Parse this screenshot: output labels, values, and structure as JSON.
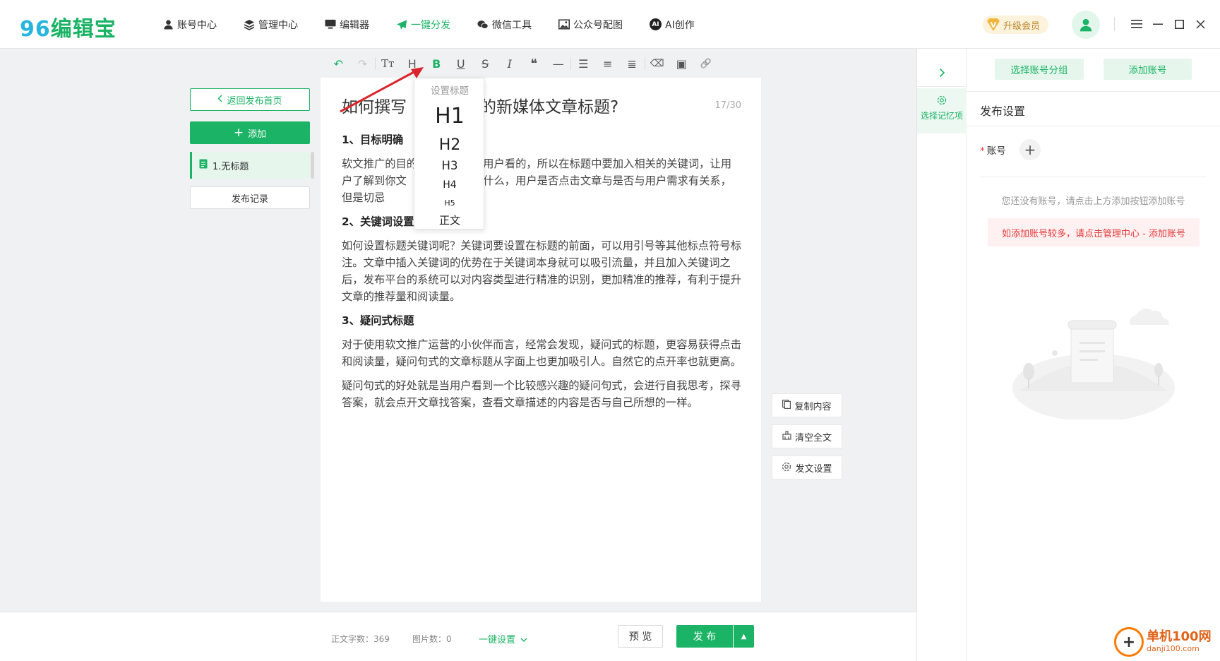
{
  "app": {
    "logo_num": "96",
    "logo_text": "编辑宝",
    "brand_color": "#1bb365"
  },
  "nav": [
    {
      "label": "账号中心",
      "icon": "user-icon"
    },
    {
      "label": "管理中心",
      "icon": "layers-icon"
    },
    {
      "label": "编辑器",
      "icon": "monitor-icon"
    },
    {
      "label": "一键分发",
      "icon": "send-icon",
      "active": true
    },
    {
      "label": "微信工具",
      "icon": "wechat-icon"
    },
    {
      "label": "公众号配图",
      "icon": "image-icon"
    },
    {
      "label": "AI创作",
      "icon": "ai-icon",
      "badge": "AI"
    }
  ],
  "header": {
    "upgrade_label": "升级会员",
    "upgrade_badge": "V"
  },
  "left": {
    "back_label": "返回发布首页",
    "add_label": "添加",
    "doc_label": "1.无标题",
    "record_label": "发布记录"
  },
  "toolbar": [
    {
      "name": "undo-button",
      "glyph": "↶"
    },
    {
      "name": "redo-button",
      "glyph": "↷"
    },
    {
      "name": "font-size-button",
      "glyph": "Tт"
    },
    {
      "name": "heading-button",
      "glyph": "H"
    },
    {
      "name": "bold-button",
      "glyph": "B"
    },
    {
      "name": "underline-button",
      "glyph": "U"
    },
    {
      "name": "strikethrough-button",
      "glyph": "S"
    },
    {
      "name": "italic-button",
      "glyph": "I"
    },
    {
      "name": "quote-button",
      "glyph": "❝"
    },
    {
      "name": "horizontal-rule-button",
      "glyph": "—"
    },
    {
      "name": "bullet-list-button",
      "glyph": "☰"
    },
    {
      "name": "align-left-button",
      "glyph": "≡"
    },
    {
      "name": "indent-button",
      "glyph": "≣"
    },
    {
      "name": "clear-format-button",
      "glyph": "⌫"
    },
    {
      "name": "insert-image-button",
      "glyph": "▣"
    },
    {
      "name": "insert-link-button",
      "glyph": "🔗"
    }
  ],
  "editor": {
    "title_part1": "如何撰写",
    "title_part2": "的新媒体文章标题?",
    "title_count": "17/30",
    "sections": [
      {
        "heading": "1、目标明确",
        "paragraphs": [
          "软文推广的目的                给用户看的，所以在标题中要加入相关的关键词，让用户了解到你文                容是什么，用户是否点击文章与是否与用户需求有关系，但是切忌"
        ]
      },
      {
        "heading": "2、关键词设置",
        "paragraphs": [
          "如何设置标题关键词呢？关键词要设置在标题的前面，可以用引号等其他标点符号标注。文章中插入关键词的优势在于关键词本身就可以吸引流量，并且加入关键词之后，发布平台的系统可以对内容类型进行精准的识别，更加精准的推荐，有利于提升文章的推荐量和阅读量。"
        ]
      },
      {
        "heading": "3、疑问式标题",
        "paragraphs": [
          "对于使用软文推广运营的小伙伴而言，经常会发现，疑问式的标题，更容易获得点击和阅读量，疑问句式的文章标题从字面上也更加吸引人。自然它的点开率也就更高。",
          "疑问句式的好处就是当用户看到一个比较感兴趣的疑问句式，会进行自我思考，探寻答案，就会点开文章找答案，查看文章描述的内容是否与自己所想的一样。"
        ]
      }
    ]
  },
  "heading_dropdown": {
    "title": "设置标题",
    "options": [
      "H1",
      "H2",
      "H3",
      "H4",
      "H5",
      "正文"
    ]
  },
  "side_actions": [
    {
      "label": "复制内容",
      "icon": "copy-icon"
    },
    {
      "label": "清空全文",
      "icon": "clear-icon"
    },
    {
      "label": "发文设置",
      "icon": "settings-icon"
    }
  ],
  "bottom": {
    "word_count": "正文字数：369",
    "image_count": "图片数：0",
    "one_click": "一键设置",
    "preview": "预 览",
    "publish": "发 布"
  },
  "right_panel": {
    "memory_label": "选择记忆项",
    "select_group": "选择账号分组",
    "add_account": "添加账号",
    "header": "发布设置",
    "account_label": "账号",
    "empty_text": "您还没有账号，请点击上方添加按钮添加账号",
    "warning": "如添加账号较多，请点击管理中心 - 添加账号"
  },
  "watermark": {
    "line1": "单机100网",
    "line2": "danji100.com"
  }
}
